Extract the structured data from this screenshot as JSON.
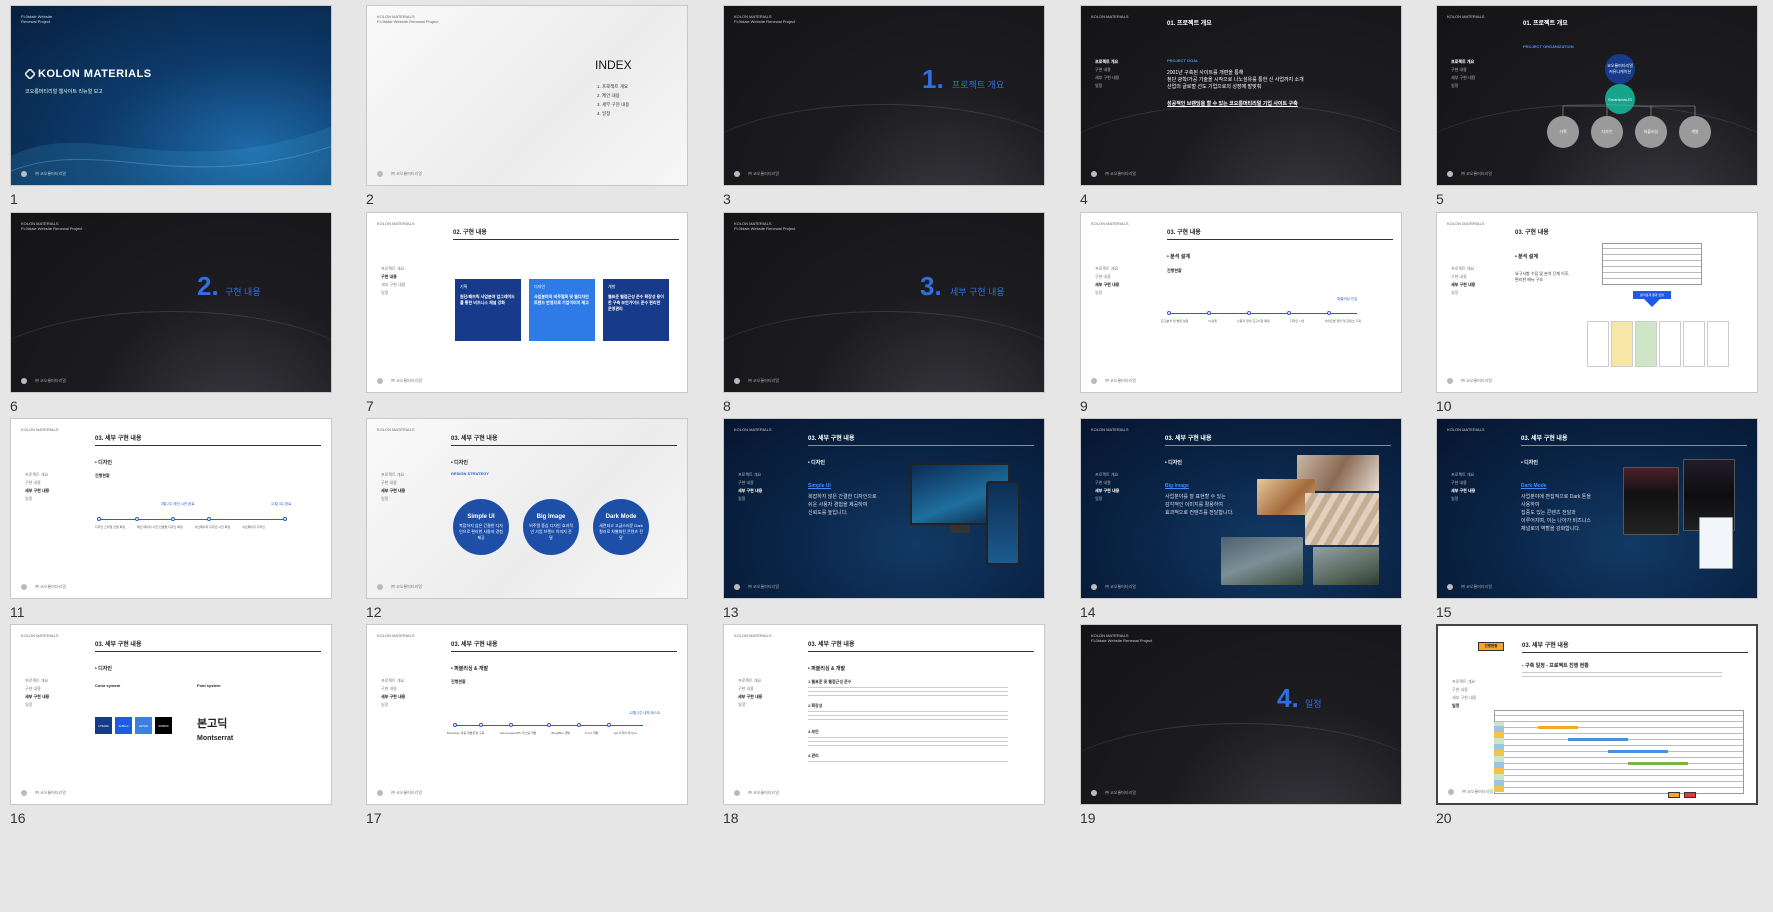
{
  "slides": [
    {
      "num": "1",
      "brand_top_1": "FL0tdale Website",
      "brand_top_2": "Renewal Project",
      "title": "KOLON MATERIALS",
      "subtitle": "코오롱머티리얼 웹사이트 리뉴얼 보고",
      "footer": "㈜ 코오롱머티리얼"
    },
    {
      "num": "2",
      "brand_1": "KOLON MATERIALS",
      "brand_2": "FL0tdale Website Renewal Project",
      "index_title": "INDEX",
      "index_items": [
        "1.  프로젝트 개요",
        "2.  제안 내용",
        "3.  세부 구현 내용",
        "4.  일정"
      ],
      "footer": "㈜ 코오롱머티리얼"
    },
    {
      "num": "3",
      "brand_1": "KOLON MATERIALS",
      "brand_2": "FL0tdale Website Renewal Project",
      "big_num": "1.",
      "label": "프로젝트 개요",
      "footer": "㈜ 코오롱머티리얼"
    },
    {
      "num": "4",
      "brand_1": "KOLON MATERIALS",
      "header": "01. 프로젝트 개요",
      "nav": [
        "프로젝트 개요",
        "구현 내용",
        "세부 구현 내용",
        "일정"
      ],
      "goal_label": "PROJECT GOAL",
      "goal_lines": [
        "2001년 구축된 사이트를 개편을 통해",
        "첨단 광학/가공 기술을 시작으로 나노섬유를 통한 신 사업까지 소개",
        "산업의 글로벌 선도 기업으로의 성장에 발맞춰"
      ],
      "goal_emph": "성공적인 브랜딩을 할 수 있는 코오롱머티리얼 기업 사이트 구축",
      "footer": "㈜ 코오롱머티리얼"
    },
    {
      "num": "5",
      "brand_1": "KOLON MATERIALS",
      "header": "01. 프로젝트 개요",
      "nav": [
        "프로젝트 개요",
        "구현 내용",
        "세부 구현 내용",
        "일정"
      ],
      "org_label": "PROJECT ORGANIZATION",
      "org_top": "코오롱머티리얼 커뮤니케이션",
      "org_mid": "SmartworkJS",
      "org_leaves": [
        "기획",
        "디자인",
        "퍼블리싱",
        "개발"
      ],
      "footer": "㈜ 코오롱머티리얼"
    },
    {
      "num": "6",
      "brand_1": "KOLON MATERIALS",
      "brand_2": "FL0tdale Website Renewal Project",
      "big_num": "2.",
      "label": "구현 내용",
      "footer": "㈜ 코오롱머티리얼"
    },
    {
      "num": "7",
      "brand_1": "KOLON MATERIALS",
      "header": "02. 구현 내용",
      "nav": [
        "프로젝트 개요",
        "구현 내용",
        "세부 구현 내용",
        "일정"
      ],
      "boxes": [
        {
          "tag": "기획",
          "text": "원단/패브릭 사업분야 업그레이드를 통한 비즈니스 채널 강화",
          "color": "#173a8a"
        },
        {
          "tag": "디자인",
          "text": "사업분야의 비주얼화 및 웹디자인 트렌드 반영으로 기업이미지 제고",
          "color": "#2e7be8"
        },
        {
          "tag": "개발",
          "text": "웹표준 웹접근성 준수 확장성 용이한 구축 보안가이드 준수 편리한 운영관리",
          "color": "#173a8a"
        }
      ],
      "footer": "㈜ 코오롱머티리얼"
    },
    {
      "num": "8",
      "brand_1": "KOLON MATERIALS",
      "brand_2": "FL0tdale Website Renewal Project",
      "big_num": "3.",
      "label": "세부 구현 내용",
      "footer": "㈜ 코오롱머티리얼"
    },
    {
      "num": "9",
      "brand_1": "KOLON MATERIALS",
      "header": "03. 구현 내용",
      "nav": [
        "프로젝트 개요",
        "구현 내용",
        "세부 구현 내용",
        "일정"
      ],
      "section": "• 분석 설계",
      "sub": "진행현황",
      "steps": [
        "요구분석 및 범위 설정",
        "IA설계",
        "사용자 정의 요구사항 확정",
        "디자인 시안",
        "사이트맵 정리 및 콘텐츠 기획"
      ],
      "end_label": "퍼블리싱 진입",
      "footer": "㈜ 코오롱머티리얼"
    },
    {
      "num": "10",
      "brand_1": "KOLON MATERIALS",
      "header": "03. 구현 내용",
      "nav": [
        "프로젝트 개요",
        "구현 내용",
        "세부 구현 내용",
        "일정"
      ],
      "section": "• 분석 설계",
      "lines": [
        "요구사항 수집 및 분석 단계 이후,",
        "편리한 메뉴 구조"
      ],
      "button": "분석설계 결과 반영",
      "footer": "㈜ 코오롱머티리얼"
    },
    {
      "num": "11",
      "brand_1": "KOLON MATERIALS",
      "header": "03. 세부 구현 내용",
      "nav": [
        "프로젝트 개요",
        "구현 내용",
        "세부 구현 내용",
        "일정"
      ],
      "section": "• 디자인",
      "sub": "진행현황",
      "mid_label": "3월 2주 메인 시안 완료",
      "end_label": "11월 3주 완료",
      "steps": [
        "디자인 스타일 컨셉 확정",
        "메인 페이지 시안 컨셉별 디자인 확정",
        "서브페이지 디자인 시안 확정",
        "서브페이지 디자인"
      ],
      "footer": "㈜ 코오롱머티리얼"
    },
    {
      "num": "12",
      "brand_1": "KOLON MATERIALS",
      "header": "03. 세부 구현 내용",
      "nav": [
        "프로젝트 개요",
        "구현 내용",
        "세부 구현 내용",
        "일정"
      ],
      "section": "• 디자인",
      "strategy": "DESIGN STRATEGY",
      "circles": [
        {
          "t": "Simple UI",
          "d": "복잡하지 않은 간결한 디자인으로 편리한 사용자 경험 제공"
        },
        {
          "t": "Big Image",
          "d": "비주얼 중심 디자인 효과적인 기업 브랜드 이미지 전달"
        },
        {
          "t": "Dark Mode",
          "d": "세련되고 고급스러운 Dark 컬러로 차별화된 콘텐츠 전달"
        }
      ],
      "footer": "㈜ 코오롱머티리얼"
    },
    {
      "num": "13",
      "brand_1": "KOLON MATERIALS",
      "header": "03. 세부 구현 내용",
      "nav": [
        "프로젝트 개요",
        "구현 내용",
        "세부 구현 내용",
        "일정"
      ],
      "section": "• 디자인",
      "link": "Simple UI",
      "lines": [
        "복잡하지 않은 간결한 디자인으로",
        "쉬운 사용자 경험을 제공하여",
        "신뢰도를 높입니다."
      ],
      "footer": "㈜ 코오롱머티리얼"
    },
    {
      "num": "14",
      "brand_1": "KOLON MATERIALS",
      "header": "03. 세부 구현 내용",
      "nav": [
        "프로젝트 개요",
        "구현 내용",
        "세부 구현 내용",
        "일정"
      ],
      "section": "• 디자인",
      "link": "Big Image",
      "lines": [
        "사업분야를 잘 표현할 수 있는",
        "감각적인 이미지를 활용하여",
        "효과적으로 컨텐츠를 전달합니다."
      ],
      "footer": "㈜ 코오롱머티리얼"
    },
    {
      "num": "15",
      "brand_1": "KOLON MATERIALS",
      "header": "03. 세부 구현 내용",
      "nav": [
        "프로젝트 개요",
        "구현 내용",
        "세부 구현 내용",
        "일정"
      ],
      "section": "• 디자인",
      "link": "Dark Mode",
      "lines": [
        "사업분야에 편집적으로 Dark 톤을",
        "사용하여",
        "집중도 있는 콘텐츠 전달과",
        "이루어지며, 이는 나아가 비즈니스",
        "채널로의 역할을 강화합니다."
      ],
      "footer": "㈜ 코오롱머티리얼"
    },
    {
      "num": "16",
      "brand_1": "KOLON MATERIALS",
      "header": "03. 세부 구현 내용",
      "nav": [
        "프로젝트 개요",
        "구현 내용",
        "세부 구현 내용",
        "일정"
      ],
      "section": "• 디자인",
      "color_label": "Color system",
      "font_label": "Font system",
      "swatches": [
        {
          "name": "173A8A",
          "color": "#173a8a"
        },
        {
          "name": "1e5be4",
          "color": "#1e5be4"
        },
        {
          "name": "3d7fe0",
          "color": "#3d7fe0"
        },
        {
          "name": "000000",
          "color": "#000000"
        }
      ],
      "font_kr": "본고딕",
      "font_en": "Montserrat",
      "footer": "㈜ 코오롱머티리얼"
    },
    {
      "num": "17",
      "brand_1": "KOLON MATERIALS",
      "header": "03. 세부 구현 내용",
      "nav": [
        "프로젝트 개요",
        "구현 내용",
        "세부 구현 내용",
        "일정"
      ],
      "section": "• 퍼블리싱 & 개발",
      "sub": "진행현황",
      "end_label": "12월 2주 내부 테스트",
      "steps": [
        "Bootstrap 적용 개발환경 구축",
        "HomepageCMS 커스텀 개발",
        "Blog/Bbs 개발",
        "Front 개발",
        "QA 다국어 및 Qna"
      ],
      "footer": "㈜ 코오롱머티리얼"
    },
    {
      "num": "18",
      "brand_1": "KOLON MATERIALS",
      "header": "03. 세부 구현 내용",
      "nav": [
        "프로젝트 개요",
        "구현 내용",
        "세부 구현 내용",
        "일정"
      ],
      "section": "• 퍼블리싱 & 개발",
      "items": [
        "1.웹표준 및 웹접근성 준수",
        "2.확장성",
        "3.보안",
        "4.관리"
      ],
      "footer": "㈜ 코오롱머티리얼"
    },
    {
      "num": "19",
      "brand_1": "KOLON MATERIALS",
      "brand_2": "FL0tdale Website Renewal Project",
      "big_num": "4.",
      "label": "일정",
      "footer": "㈜ 코오롱머티리얼"
    },
    {
      "num": "20",
      "tag": "진행현황",
      "header": "03. 세부 구현 내용",
      "nav": [
        "프로젝트 개요",
        "구현 내용",
        "세부 구현 내용",
        "일정"
      ],
      "section": "- 구축 일정 - 프로젝트 진행 현황",
      "footer": "㈜ 코오롱머티리얼"
    }
  ]
}
